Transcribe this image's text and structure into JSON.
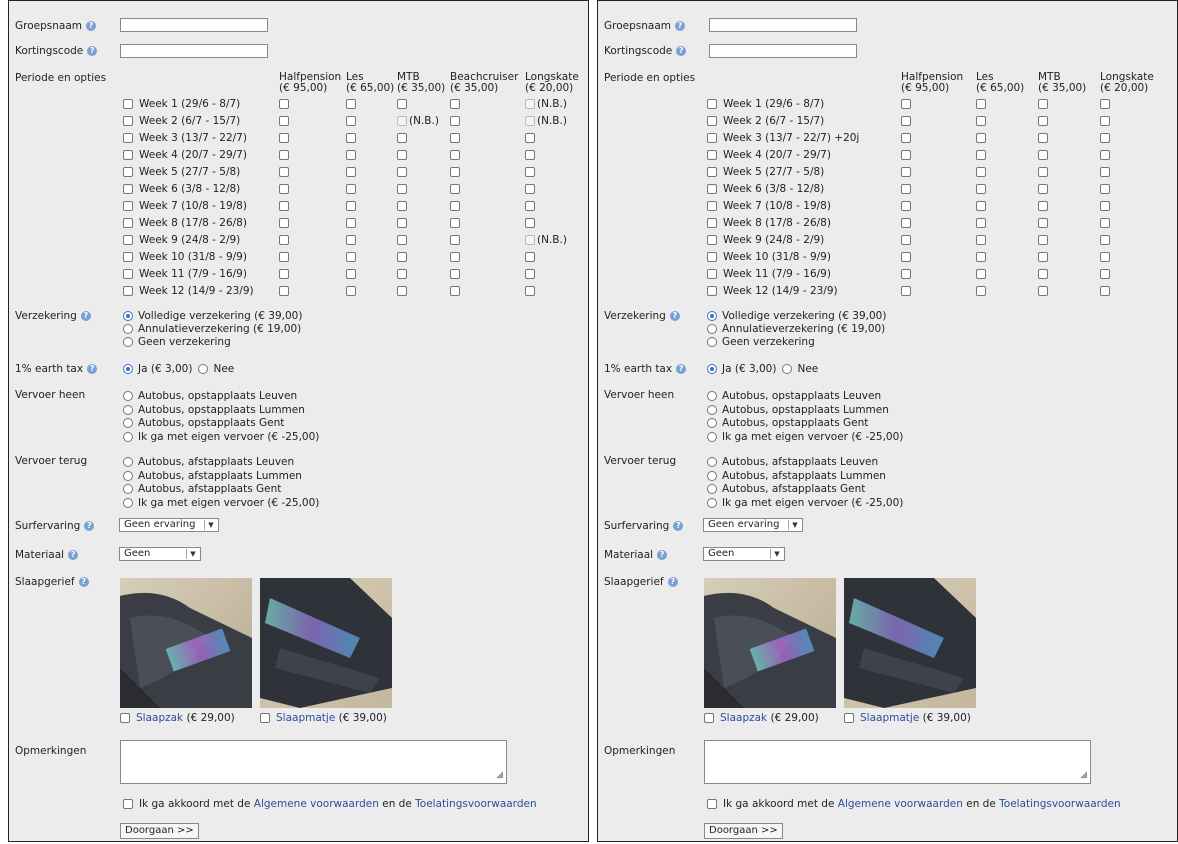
{
  "panels": [
    {
      "labels": {
        "group": "Groepsnaam",
        "discount": "Kortingscode",
        "period": "Periode en opties",
        "insurance": "Verzekering",
        "earthtax": "1% earth tax",
        "transport_out": "Vervoer heen",
        "transport_back": "Vervoer terug",
        "surf": "Surfervaring",
        "material": "Materiaal",
        "sleep": "Slaapgerief",
        "remarks": "Opmerkingen"
      },
      "option_columns": [
        {
          "name": "Halfpension",
          "price": "(€ 95,00)"
        },
        {
          "name": "Les",
          "price": "(€ 65,00)"
        },
        {
          "name": "MTB",
          "price": "(€ 35,00)"
        },
        {
          "name": "Beachcruiser",
          "price": "(€ 35,00)"
        },
        {
          "name": "Longskate",
          "price": "(€ 20,00)"
        }
      ],
      "weeks": [
        "Week 1 (29/6 - 8/7)",
        "Week 2 (6/7 - 15/7)",
        "Week 3 (13/7 - 22/7)",
        "Week 4 (20/7 - 29/7)",
        "Week 5 (27/7 - 5/8)",
        "Week 6 (3/8 - 12/8)",
        "Week 7 (10/8 - 19/8)",
        "Week 8 (17/8 - 26/8)",
        "Week 9 (24/8 - 2/9)",
        "Week 10 (31/8 - 9/9)",
        "Week 11 (7/9 - 16/9)",
        "Week 12 (14/9 - 23/9)"
      ],
      "na_text": "(N.B.)",
      "na_cells": [
        [
          0,
          4
        ],
        [
          1,
          2
        ],
        [
          1,
          4
        ],
        [
          8,
          4
        ]
      ],
      "insurance_options": [
        "Volledige verzekering (€ 39,00)",
        "Annulatieverzekering (€ 19,00)",
        "Geen verzekering"
      ],
      "insurance_selected": 0,
      "earthtax_yes": "Ja (€ 3,00)",
      "earthtax_no": "Nee",
      "transport_out_options": [
        "Autobus, opstapplaats Leuven",
        "Autobus, opstapplaats Lummen",
        "Autobus, opstapplaats Gent",
        "Ik ga met eigen vervoer (€ -25,00)"
      ],
      "transport_back_options": [
        "Autobus, afstapplaats Leuven",
        "Autobus, afstapplaats Lummen",
        "Autobus, afstapplaats Gent",
        "Ik ga met eigen vervoer (€ -25,00)"
      ],
      "surf_value": "Geen ervaring",
      "material_value": "Geen",
      "sleep_items": [
        {
          "link": "Slaapzak",
          "price": " (€ 29,00)"
        },
        {
          "link": "Slaapmatje",
          "price": " (€ 39,00)"
        }
      ],
      "terms": {
        "pre": "Ik ga akkoord met de ",
        "link1": "Algemene voorwaarden",
        "mid": " en de ",
        "link2": "Toelatingsvoorwaarden"
      },
      "continue_label": "Doorgaan >>"
    },
    {
      "labels": {
        "group": "Groepsnaam",
        "discount": "Kortingscode",
        "period": "Periode en opties",
        "insurance": "Verzekering",
        "earthtax": "1% earth tax",
        "transport_out": "Vervoer heen",
        "transport_back": "Vervoer terug",
        "surf": "Surfervaring",
        "material": "Materiaal",
        "sleep": "Slaapgerief",
        "remarks": "Opmerkingen"
      },
      "option_columns": [
        {
          "name": "Halfpension",
          "price": "(€ 95,00)"
        },
        {
          "name": "Les",
          "price": "(€ 65,00)"
        },
        {
          "name": "MTB",
          "price": "(€ 35,00)"
        },
        {
          "name": "Longskate",
          "price": "(€ 20,00)"
        }
      ],
      "weeks": [
        "Week 1 (29/6 - 8/7)",
        "Week 2 (6/7 - 15/7)",
        "Week 3 (13/7 - 22/7) +20j",
        "Week 4 (20/7 - 29/7)",
        "Week 5 (27/7 - 5/8)",
        "Week 6 (3/8 - 12/8)",
        "Week 7 (10/8 - 19/8)",
        "Week 8 (17/8 - 26/8)",
        "Week 9 (24/8 - 2/9)",
        "Week 10 (31/8 - 9/9)",
        "Week 11 (7/9 - 16/9)",
        "Week 12 (14/9 - 23/9)"
      ],
      "na_text": "(N.B.)",
      "na_cells": [],
      "insurance_options": [
        "Volledige verzekering (€ 39,00)",
        "Annulatieverzekering (€ 19,00)",
        "Geen verzekering"
      ],
      "insurance_selected": 0,
      "earthtax_yes": "Ja (€ 3,00)",
      "earthtax_no": "Nee",
      "transport_out_options": [
        "Autobus, opstapplaats Leuven",
        "Autobus, opstapplaats Lummen",
        "Autobus, opstapplaats Gent",
        "Ik ga met eigen vervoer (€ -25,00)"
      ],
      "transport_back_options": [
        "Autobus, afstapplaats Leuven",
        "Autobus, afstapplaats Lummen",
        "Autobus, afstapplaats Gent",
        "Ik ga met eigen vervoer (€ -25,00)"
      ],
      "surf_value": "Geen ervaring",
      "material_value": "Geen",
      "sleep_items": [
        {
          "link": "Slaapzak",
          "price": " (€ 29,00)"
        },
        {
          "link": "Slaapmatje",
          "price": " (€ 39,00)"
        }
      ],
      "terms": {
        "pre": "Ik ga akkoord met de ",
        "link1": "Algemene voorwaarden",
        "mid": " en de ",
        "link2": "Toelatingsvoorwaarden"
      },
      "continue_label": "Doorgaan >>"
    }
  ],
  "icons": {
    "help": "help-question-icon",
    "resize": "resize-grip-icon"
  },
  "colors": {
    "link": "#2a4d9c",
    "radio_selected": "#3b6fc4",
    "panel_bg": "#ececec",
    "help_icon": "#7aa0d6"
  }
}
